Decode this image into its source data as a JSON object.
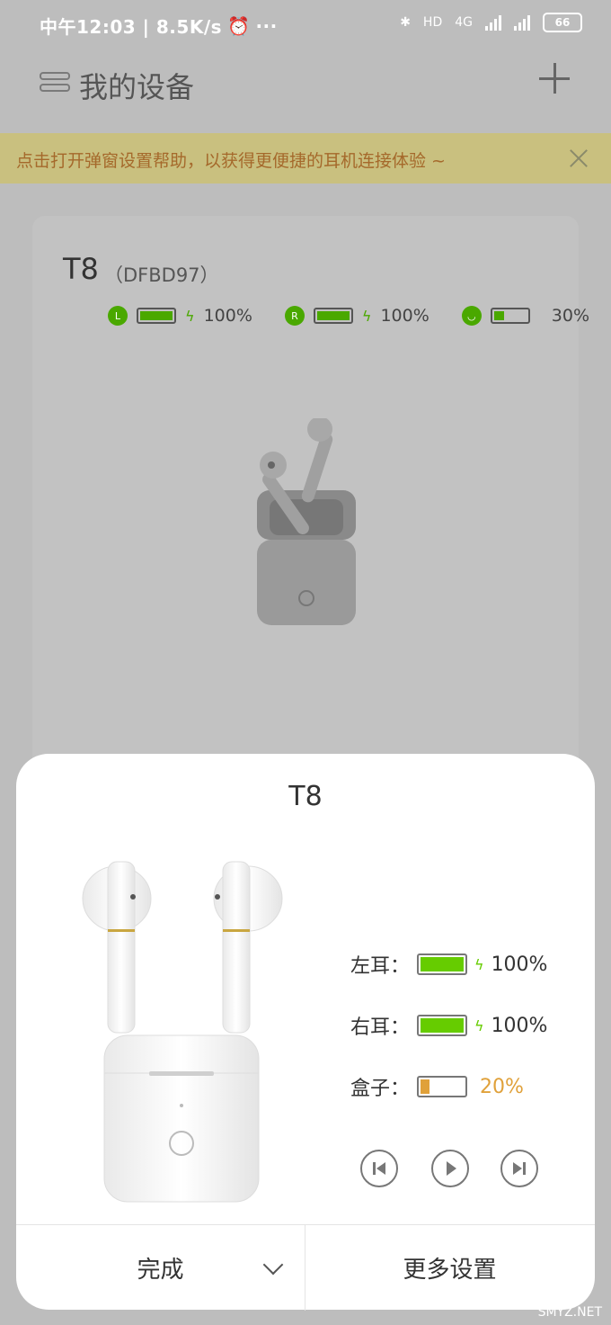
{
  "statusbar": {
    "time": "中午12:03 | 8.5K/s",
    "network": "4G",
    "hd": "HD",
    "battery": "66"
  },
  "header": {
    "title": "我的设备"
  },
  "banner": {
    "text": "点击打开弹窗设置帮助，以获得更便捷的耳机连接体验 ~"
  },
  "device": {
    "name": "T8",
    "id": "（DFBD97）",
    "left": {
      "badge": "L",
      "pct": "100%",
      "level": 1.0
    },
    "right": {
      "badge": "R",
      "pct": "100%",
      "level": 1.0
    },
    "case": {
      "pct": "30%",
      "level": 0.3
    }
  },
  "sheet": {
    "title": "T8",
    "left_label": "左耳：",
    "right_label": "右耳：",
    "case_label": "盒子：",
    "left_pct": "100%",
    "right_pct": "100%",
    "case_pct": "20%",
    "case_level": 0.2,
    "done_label": "完成",
    "more_label": "更多设置"
  },
  "colors": {
    "green": "#66cc00",
    "case_orange": "#e0a13a",
    "accent_green": "#4aa800"
  },
  "watermark": "SMYZ.NET"
}
